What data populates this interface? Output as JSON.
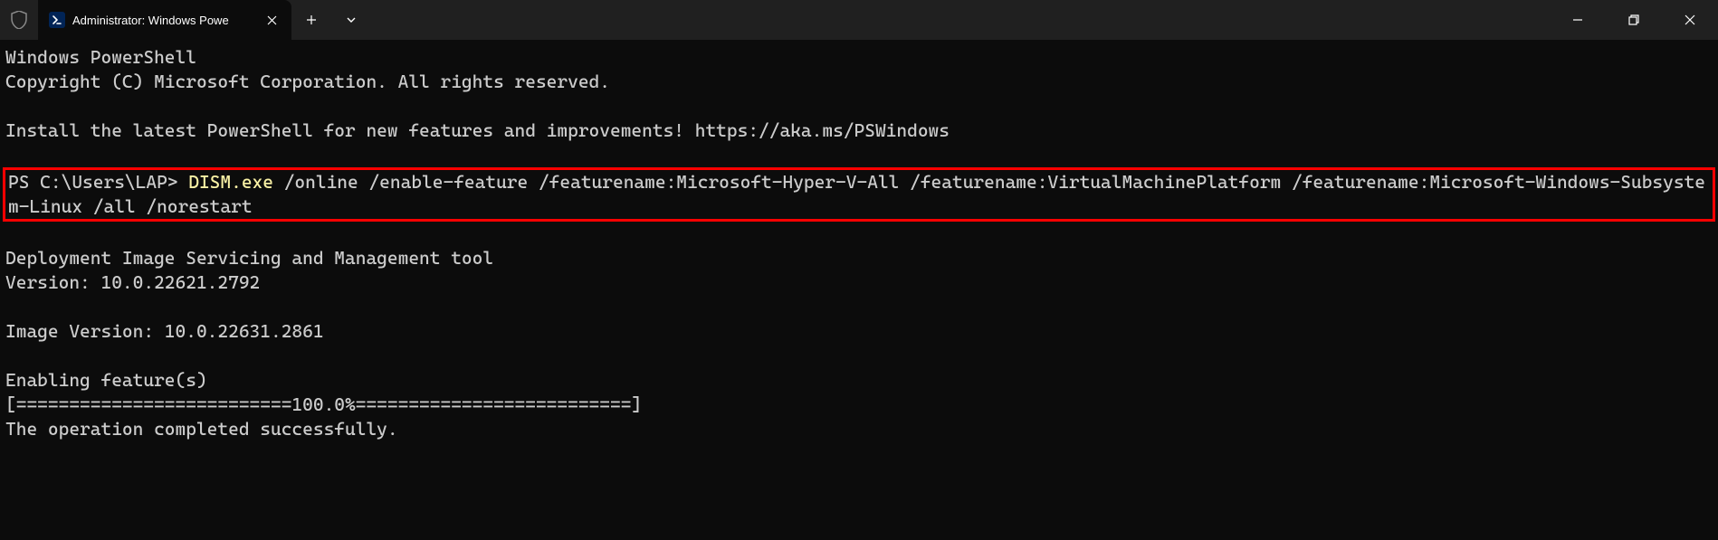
{
  "titlebar": {
    "tab_title": "Administrator: Windows Powe"
  },
  "terminal": {
    "header_line1": "Windows PowerShell",
    "header_line2": "Copyright (C) Microsoft Corporation. All rights reserved.",
    "install_hint": "Install the latest PowerShell for new features and improvements! https://aka.ms/PSWindows",
    "prompt": "PS C:\\Users\\LAP> ",
    "cmd_exec": "DISM.exe",
    "cmd_args": " /online /enable-feature /featurename:Microsoft-Hyper-V-All /featurename:VirtualMachinePlatform /featurename:Microsoft-Windows-Subsystem-Linux /all /norestart",
    "dism_line1": "Deployment Image Servicing and Management tool",
    "dism_line2": "Version: 10.0.22621.2792",
    "image_version": "Image Version: 10.0.22631.2861",
    "enabling": "Enabling feature(s)",
    "progress": "[==========================100.0%==========================]",
    "completed": "The operation completed successfully."
  }
}
